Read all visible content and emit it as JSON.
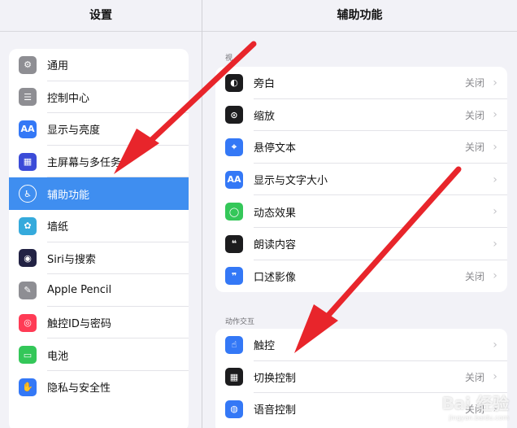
{
  "left": {
    "title": "设置",
    "items": [
      {
        "label": "通用",
        "icon": "gear-icon",
        "color": "#8e8e93",
        "glyph": "⚙"
      },
      {
        "label": "控制中心",
        "icon": "switches-icon",
        "color": "#8e8e93",
        "glyph": "☰"
      },
      {
        "label": "显示与亮度",
        "icon": "text-size-icon",
        "color": "#3478f6",
        "glyph": "AA"
      },
      {
        "label": "主屏幕与多任务",
        "icon": "home-grid-icon",
        "color": "#3b4bd8",
        "glyph": "▦"
      },
      {
        "label": "辅助功能",
        "icon": "accessibility-icon",
        "color": "#3f8ef0",
        "glyph": "♿"
      },
      {
        "label": "墙纸",
        "icon": "flower-icon",
        "color": "#35aadc",
        "glyph": "✿"
      },
      {
        "label": "Siri与搜索",
        "icon": "siri-icon",
        "color": "#222244",
        "glyph": "◉"
      },
      {
        "label": "Apple Pencil",
        "icon": "pencil-icon",
        "color": "#8e8e93",
        "glyph": "✎"
      },
      {
        "label": "触控ID与密码",
        "icon": "fingerprint-icon",
        "color": "#ff3b55",
        "glyph": "◎"
      },
      {
        "label": "电池",
        "icon": "battery-icon",
        "color": "#34c759",
        "glyph": "▭"
      },
      {
        "label": "隐私与安全性",
        "icon": "hand-icon",
        "color": "#3478f6",
        "glyph": "✋"
      }
    ],
    "selected_index": 4
  },
  "right": {
    "title": "辅助功能",
    "section1_header": "视",
    "section1": [
      {
        "label": "旁白",
        "icon": "voiceover-icon",
        "color": "#1c1c1e",
        "glyph": "◐",
        "value": "关闭"
      },
      {
        "label": "缩放",
        "icon": "zoom-icon",
        "color": "#1c1c1e",
        "glyph": "⊙",
        "value": "关闭"
      },
      {
        "label": "悬停文本",
        "icon": "hover-text-icon",
        "color": "#3478f6",
        "glyph": "⌖",
        "value": "关闭"
      },
      {
        "label": "显示与文字大小",
        "icon": "text-size-icon",
        "color": "#3478f6",
        "glyph": "AA",
        "value": ""
      },
      {
        "label": "动态效果",
        "icon": "motion-icon",
        "color": "#34c759",
        "glyph": "◯",
        "value": ""
      },
      {
        "label": "朗读内容",
        "icon": "speech-icon",
        "color": "#1c1c1e",
        "glyph": "❝",
        "value": ""
      },
      {
        "label": "口述影像",
        "icon": "audio-description-icon",
        "color": "#3478f6",
        "glyph": "❞",
        "value": "关闭"
      }
    ],
    "section2_header": "动作交互",
    "section2": [
      {
        "label": "触控",
        "icon": "touch-hand-icon",
        "color": "#3478f6",
        "glyph": "☝",
        "value": ""
      },
      {
        "label": "切换控制",
        "icon": "switch-control-icon",
        "color": "#1c1c1e",
        "glyph": "▦",
        "value": "关闭"
      },
      {
        "label": "语音控制",
        "icon": "voice-control-icon",
        "color": "#3478f6",
        "glyph": "◍",
        "value": "关闭"
      }
    ]
  },
  "accent_color": "#3f8ef0",
  "annotation_color": "#e8252b",
  "watermark": {
    "brand": "Bai 经验",
    "url": "jingyan.baidu.com"
  }
}
